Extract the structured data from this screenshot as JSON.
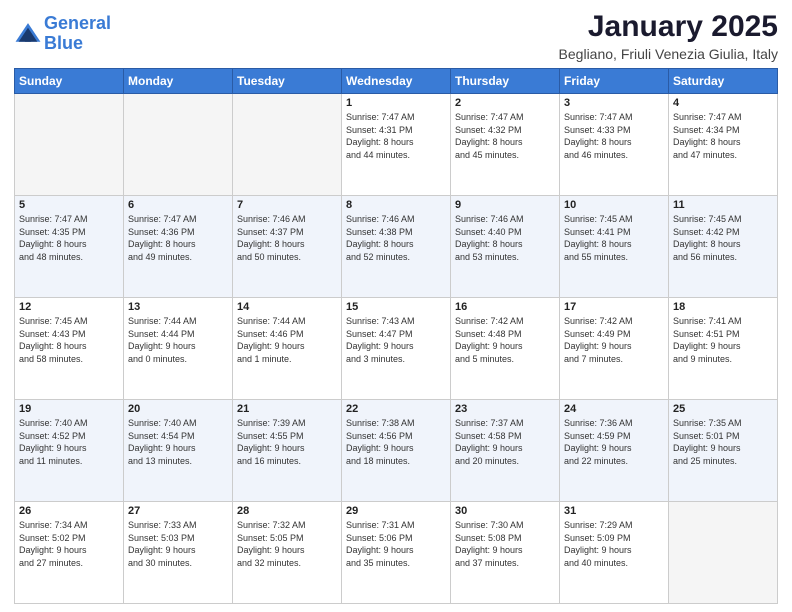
{
  "header": {
    "logo_line1": "General",
    "logo_line2": "Blue",
    "title": "January 2025",
    "subtitle": "Begliano, Friuli Venezia Giulia, Italy"
  },
  "weekdays": [
    "Sunday",
    "Monday",
    "Tuesday",
    "Wednesday",
    "Thursday",
    "Friday",
    "Saturday"
  ],
  "weeks": [
    {
      "days": [
        {
          "num": "",
          "info": ""
        },
        {
          "num": "",
          "info": ""
        },
        {
          "num": "",
          "info": ""
        },
        {
          "num": "1",
          "info": "Sunrise: 7:47 AM\nSunset: 4:31 PM\nDaylight: 8 hours\nand 44 minutes."
        },
        {
          "num": "2",
          "info": "Sunrise: 7:47 AM\nSunset: 4:32 PM\nDaylight: 8 hours\nand 45 minutes."
        },
        {
          "num": "3",
          "info": "Sunrise: 7:47 AM\nSunset: 4:33 PM\nDaylight: 8 hours\nand 46 minutes."
        },
        {
          "num": "4",
          "info": "Sunrise: 7:47 AM\nSunset: 4:34 PM\nDaylight: 8 hours\nand 47 minutes."
        }
      ]
    },
    {
      "days": [
        {
          "num": "5",
          "info": "Sunrise: 7:47 AM\nSunset: 4:35 PM\nDaylight: 8 hours\nand 48 minutes."
        },
        {
          "num": "6",
          "info": "Sunrise: 7:47 AM\nSunset: 4:36 PM\nDaylight: 8 hours\nand 49 minutes."
        },
        {
          "num": "7",
          "info": "Sunrise: 7:46 AM\nSunset: 4:37 PM\nDaylight: 8 hours\nand 50 minutes."
        },
        {
          "num": "8",
          "info": "Sunrise: 7:46 AM\nSunset: 4:38 PM\nDaylight: 8 hours\nand 52 minutes."
        },
        {
          "num": "9",
          "info": "Sunrise: 7:46 AM\nSunset: 4:40 PM\nDaylight: 8 hours\nand 53 minutes."
        },
        {
          "num": "10",
          "info": "Sunrise: 7:45 AM\nSunset: 4:41 PM\nDaylight: 8 hours\nand 55 minutes."
        },
        {
          "num": "11",
          "info": "Sunrise: 7:45 AM\nSunset: 4:42 PM\nDaylight: 8 hours\nand 56 minutes."
        }
      ]
    },
    {
      "days": [
        {
          "num": "12",
          "info": "Sunrise: 7:45 AM\nSunset: 4:43 PM\nDaylight: 8 hours\nand 58 minutes."
        },
        {
          "num": "13",
          "info": "Sunrise: 7:44 AM\nSunset: 4:44 PM\nDaylight: 9 hours\nand 0 minutes."
        },
        {
          "num": "14",
          "info": "Sunrise: 7:44 AM\nSunset: 4:46 PM\nDaylight: 9 hours\nand 1 minute."
        },
        {
          "num": "15",
          "info": "Sunrise: 7:43 AM\nSunset: 4:47 PM\nDaylight: 9 hours\nand 3 minutes."
        },
        {
          "num": "16",
          "info": "Sunrise: 7:42 AM\nSunset: 4:48 PM\nDaylight: 9 hours\nand 5 minutes."
        },
        {
          "num": "17",
          "info": "Sunrise: 7:42 AM\nSunset: 4:49 PM\nDaylight: 9 hours\nand 7 minutes."
        },
        {
          "num": "18",
          "info": "Sunrise: 7:41 AM\nSunset: 4:51 PM\nDaylight: 9 hours\nand 9 minutes."
        }
      ]
    },
    {
      "days": [
        {
          "num": "19",
          "info": "Sunrise: 7:40 AM\nSunset: 4:52 PM\nDaylight: 9 hours\nand 11 minutes."
        },
        {
          "num": "20",
          "info": "Sunrise: 7:40 AM\nSunset: 4:54 PM\nDaylight: 9 hours\nand 13 minutes."
        },
        {
          "num": "21",
          "info": "Sunrise: 7:39 AM\nSunset: 4:55 PM\nDaylight: 9 hours\nand 16 minutes."
        },
        {
          "num": "22",
          "info": "Sunrise: 7:38 AM\nSunset: 4:56 PM\nDaylight: 9 hours\nand 18 minutes."
        },
        {
          "num": "23",
          "info": "Sunrise: 7:37 AM\nSunset: 4:58 PM\nDaylight: 9 hours\nand 20 minutes."
        },
        {
          "num": "24",
          "info": "Sunrise: 7:36 AM\nSunset: 4:59 PM\nDaylight: 9 hours\nand 22 minutes."
        },
        {
          "num": "25",
          "info": "Sunrise: 7:35 AM\nSunset: 5:01 PM\nDaylight: 9 hours\nand 25 minutes."
        }
      ]
    },
    {
      "days": [
        {
          "num": "26",
          "info": "Sunrise: 7:34 AM\nSunset: 5:02 PM\nDaylight: 9 hours\nand 27 minutes."
        },
        {
          "num": "27",
          "info": "Sunrise: 7:33 AM\nSunset: 5:03 PM\nDaylight: 9 hours\nand 30 minutes."
        },
        {
          "num": "28",
          "info": "Sunrise: 7:32 AM\nSunset: 5:05 PM\nDaylight: 9 hours\nand 32 minutes."
        },
        {
          "num": "29",
          "info": "Sunrise: 7:31 AM\nSunset: 5:06 PM\nDaylight: 9 hours\nand 35 minutes."
        },
        {
          "num": "30",
          "info": "Sunrise: 7:30 AM\nSunset: 5:08 PM\nDaylight: 9 hours\nand 37 minutes."
        },
        {
          "num": "31",
          "info": "Sunrise: 7:29 AM\nSunset: 5:09 PM\nDaylight: 9 hours\nand 40 minutes."
        },
        {
          "num": "",
          "info": ""
        }
      ]
    }
  ]
}
